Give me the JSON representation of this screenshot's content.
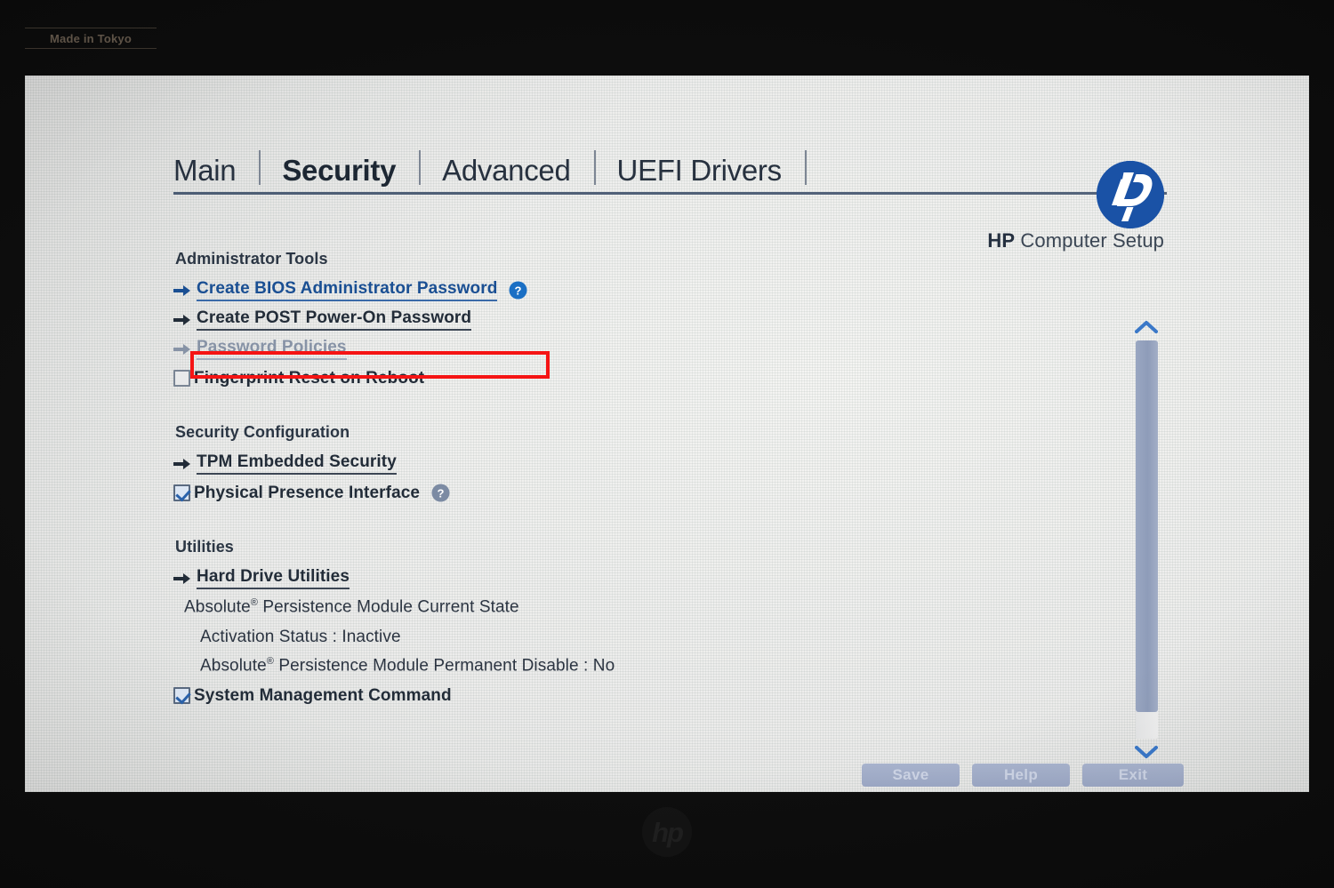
{
  "bezel": {
    "label": "Made in Tokyo",
    "logo_icon": "hp-logo-icon"
  },
  "header": {
    "tabs": [
      {
        "label": "Main",
        "active": false
      },
      {
        "label": "Security",
        "active": true
      },
      {
        "label": "Advanced",
        "active": false
      },
      {
        "label": "UEFI Drivers",
        "active": false
      }
    ],
    "logo_icon": "hp-logo-icon",
    "title_brand": "HP",
    "title_rest": " Computer Setup"
  },
  "groups": {
    "administrator_tools": {
      "heading": "Administrator Tools",
      "items": {
        "create_bios_admin_password": "Create BIOS Administrator Password",
        "create_post_power_on_password": "Create POST Power-On Password",
        "password_policies": "Password Policies",
        "fingerprint_reset_on_reboot": "Fingerprint Reset on Reboot"
      }
    },
    "security_configuration": {
      "heading": "Security Configuration",
      "items": {
        "tpm_embedded_security": "TPM Embedded Security",
        "physical_presence_interface": "Physical Presence Interface"
      }
    },
    "utilities": {
      "heading": "Utilities",
      "items": {
        "hard_drive_utilities": "Hard Drive Utilities",
        "absolute_current_state": "Absolute",
        "absolute_current_state_rest": " Persistence Module Current State",
        "activation_status": "Activation Status : Inactive",
        "absolute_permanent_disable": "Absolute",
        "absolute_permanent_disable_rest": " Persistence Module Permanent Disable : No",
        "system_management_command": "System Management Command"
      }
    }
  },
  "checkboxes": {
    "fingerprint_reset_on_reboot": false,
    "physical_presence_interface": true,
    "system_management_command": true
  },
  "registered_mark": "®",
  "scrollbar": {
    "up_icon": "chevron-up-icon",
    "down_icon": "chevron-down-icon"
  },
  "footer": {
    "save_label": "Save",
    "help_label": "Help",
    "exit_label": "Exit"
  },
  "icons": {
    "arrow": "arrow-right-icon",
    "help": "help-circle-icon"
  },
  "colors": {
    "link_blue": "#1a4f93",
    "dark_text": "#222c38",
    "dim_text": "#8793a6",
    "hp_blue": "#1a52a6",
    "annotation_red": "#f51414",
    "button_blue": "#9ba7c4",
    "scrollbar_thumb": "#8e9cb9"
  },
  "annotation": {
    "highlight_target": "Create BIOS Administrator Password",
    "color": "#f51414"
  }
}
